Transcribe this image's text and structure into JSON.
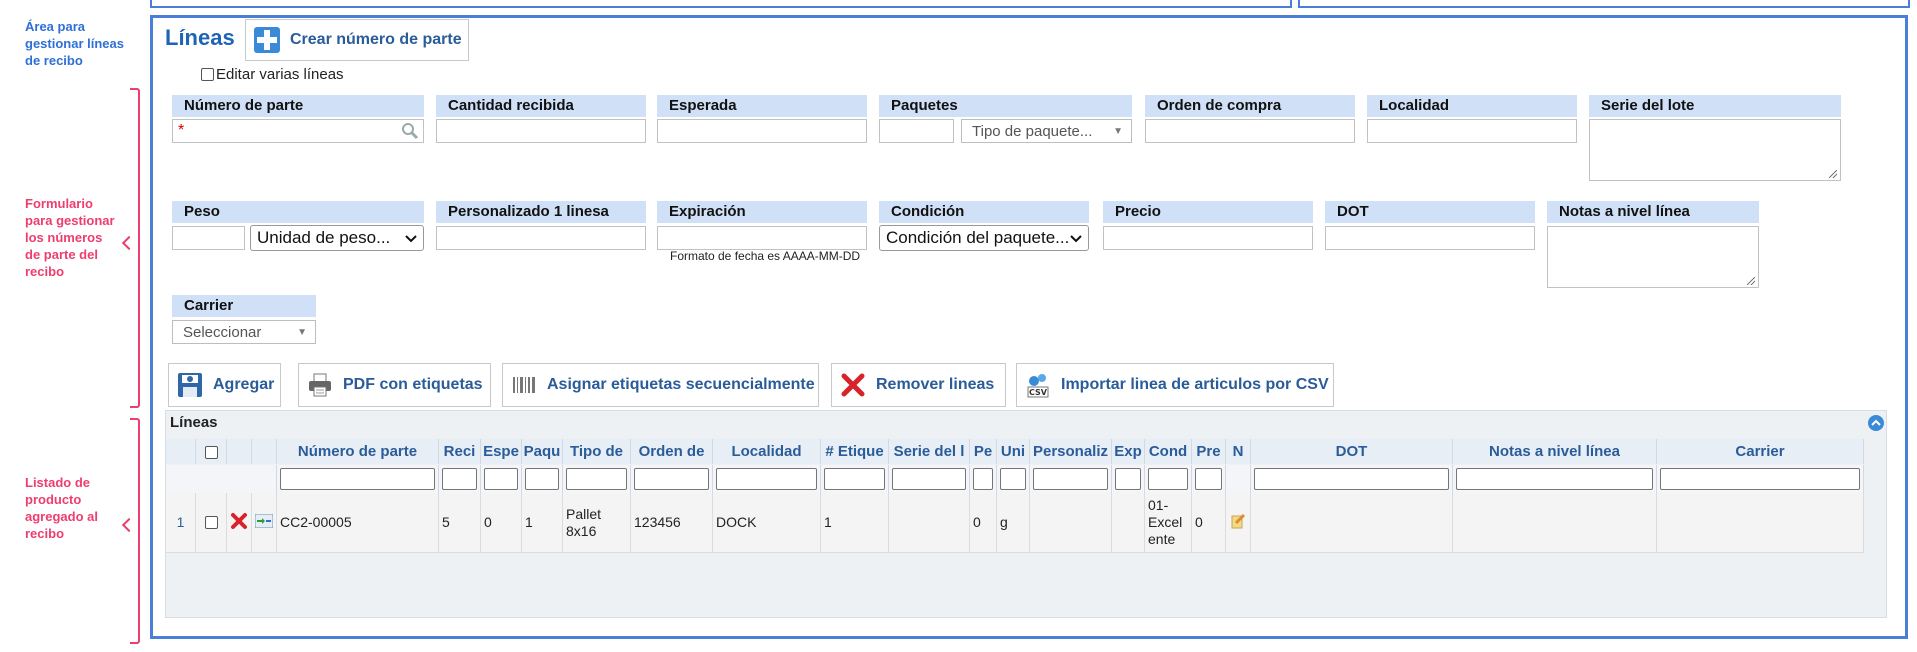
{
  "annotations": {
    "area": "Área para gestionar líneas de recibo",
    "form": "Formulario para gestionar los números de parte del recibo",
    "list": "Listado de producto agregado al recibo"
  },
  "section": {
    "title": "Líneas",
    "create_part_button": "Crear número de parte",
    "edit_multiple_label": "Editar varias líneas"
  },
  "form": {
    "part_number": "Número de parte",
    "qty_received": "Cantidad recibida",
    "expected": "Esperada",
    "packages": "Paquetes",
    "package_type_placeholder": "Tipo de paquete...",
    "purchase_order": "Orden de compra",
    "location": "Localidad",
    "lot_serial": "Serie del lote",
    "weight": "Peso",
    "weight_unit": "Unidad de peso...",
    "custom1": "Personalizado 1 linesa",
    "expiration": "Expiración",
    "date_hint": "Formato de fecha es AAAA-MM-DD",
    "condition": "Condición",
    "condition_placeholder": "Condición del paquete...",
    "price": "Precio",
    "dot": "DOT",
    "line_notes": "Notas a nivel línea",
    "carrier": "Carrier",
    "carrier_placeholder": "Seleccionar",
    "required_mark": "*"
  },
  "actions": {
    "add": "Agregar",
    "pdf_labels": "PDF con etiquetas",
    "assign_seq": "Asignar etiquetas secuencialmente",
    "remove": "Remover lineas",
    "import_csv": "Importar linea de articulos por CSV"
  },
  "grid": {
    "caption": "Líneas",
    "headers": [
      "Número de parte",
      "Reci",
      "Espe",
      "Paqu",
      "Tipo de",
      "Orden de",
      "Localidad",
      "# Etique",
      "Serie del l",
      "Pe",
      "Uni",
      "Personaliz",
      "Exp",
      "Cond",
      "Pre",
      "N",
      "DOT",
      "Notas a nivel línea",
      "Carrier"
    ],
    "row": {
      "index": "1",
      "part_number": "CC2-00005",
      "received": "5",
      "expected": "0",
      "packages": "1",
      "package_type": "Pallet 8x16",
      "purchase_order": "123456",
      "location": "DOCK",
      "labels": "1",
      "lot_serial": "",
      "weight": "0",
      "unit": "g",
      "custom": "",
      "expiration": "",
      "condition": "01-Excel ente",
      "price": "0"
    }
  },
  "colors": {
    "frame": "#4a7fd8",
    "accent": "#1f63b6",
    "annotation_pink": "#ee3d6f",
    "label_bg": "#cfe0f7"
  }
}
